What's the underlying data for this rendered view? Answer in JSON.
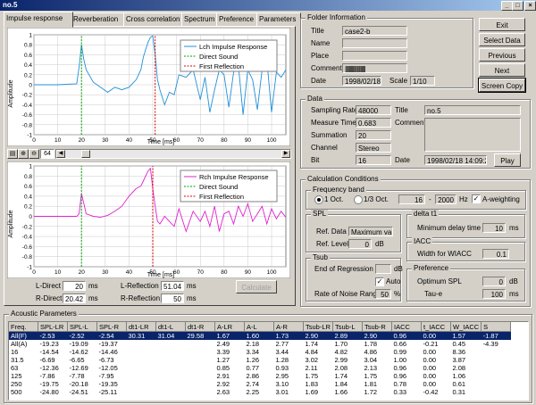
{
  "window": {
    "title": "no.5"
  },
  "tabs": [
    "Impulse response",
    "Reverberation",
    "Cross correlation",
    "Spectrum",
    "Preference",
    "Parameters"
  ],
  "chart_l": {
    "ylabel": "Amplitude",
    "xlabel": "Time [ms]",
    "yticks": [
      "1",
      "0.8",
      "0.6",
      "0.4",
      "0.2",
      "0",
      "-0.2",
      "-0.4",
      "-0.6",
      "-0.8",
      "-1"
    ],
    "xticks": [
      "0",
      "10",
      "20",
      "30",
      "40",
      "50",
      "60",
      "70",
      "80",
      "90",
      "100"
    ],
    "legend": [
      "Lch Impulse Response",
      "Direct Sound",
      "First Reflection"
    ]
  },
  "chart_r": {
    "ylabel": "Amplitude",
    "xlabel": "Time [ms]",
    "yticks": [
      "1",
      "0.8",
      "0.6",
      "0.4",
      "0.2",
      "0",
      "-0.2",
      "-0.4",
      "-0.6",
      "-0.8",
      "-1"
    ],
    "xticks": [
      "0",
      "10",
      "20",
      "30",
      "40",
      "50",
      "60",
      "70",
      "80",
      "90",
      "100"
    ],
    "legend": [
      "Rch Impulse Response",
      "Direct Sound",
      "First Reflection"
    ]
  },
  "chart_data": [
    {
      "type": "line",
      "name": "Lch",
      "xlabel": "Time [ms]",
      "ylabel": "Amplitude",
      "xlim": [
        0,
        106
      ],
      "ylim": [
        -1,
        1
      ],
      "grid": true,
      "series": [
        {
          "name": "Lch Impulse Response",
          "x": [
            0,
            10,
            18,
            19,
            20,
            21,
            22,
            25,
            28,
            31,
            34,
            37,
            40,
            43,
            45,
            46,
            47,
            48,
            49,
            50,
            51,
            52,
            53,
            55,
            57,
            59,
            61,
            64,
            67,
            70,
            72,
            74,
            76,
            78,
            80,
            82,
            84,
            86,
            88,
            90,
            92,
            94,
            96,
            98,
            100,
            102,
            104,
            106
          ],
          "y": [
            0,
            0,
            0.02,
            0.35,
            0.8,
            0.5,
            0.3,
            0.05,
            -0.05,
            -0.15,
            -0.05,
            -0.1,
            -0.05,
            0.1,
            0.3,
            0.55,
            0.7,
            0.85,
            0.95,
            0.98,
            0.6,
            0.1,
            -0.1,
            -0.4,
            -0.15,
            -0.2,
            0.2,
            0.15,
            0.3,
            -0.3,
            0.15,
            -0.55,
            -0.1,
            0.3,
            0.2,
            -0.45,
            0.25,
            0.4,
            -0.6,
            0.3,
            0.1,
            -0.5,
            0.3,
            0.5,
            -0.55,
            0.25,
            0.15,
            0.3
          ]
        },
        {
          "name": "Direct Sound",
          "x": [
            20,
            20
          ],
          "y": [
            -1,
            1
          ]
        },
        {
          "name": "First Reflection",
          "x": [
            51,
            51
          ],
          "y": [
            -1,
            1
          ]
        }
      ]
    },
    {
      "type": "line",
      "name": "Rch",
      "xlabel": "Time [ms]",
      "ylabel": "Amplitude",
      "xlim": [
        0,
        106
      ],
      "ylim": [
        -1,
        1
      ],
      "grid": true,
      "series": [
        {
          "name": "Rch Impulse Response",
          "x": [
            0,
            10,
            18,
            19,
            20,
            21,
            22,
            25,
            28,
            31,
            34,
            37,
            40,
            43,
            45,
            46,
            47,
            48,
            49,
            50,
            51,
            52,
            53,
            55,
            57,
            59,
            61,
            64,
            67,
            70,
            72,
            74,
            76,
            78,
            80,
            82,
            84,
            86,
            88,
            90,
            92,
            94,
            96,
            98,
            100,
            102,
            104,
            106
          ],
          "y": [
            0,
            0,
            0,
            0.05,
            0.45,
            0.25,
            0.05,
            0,
            -0.02,
            0.02,
            0.1,
            0.2,
            0.4,
            0.55,
            0.6,
            0.7,
            0.8,
            0.9,
            0.95,
            0.55,
            0.2,
            -0.1,
            -0.15,
            0,
            -0.1,
            -0.2,
            0.15,
            -0.3,
            0.1,
            -0.1,
            0.1,
            -0.2,
            0.2,
            -0.3,
            0.05,
            0.1,
            -0.15,
            0.2,
            0,
            0.25,
            -0.1,
            0.05,
            0.2,
            -0.15,
            0.15,
            -0.05,
            0.1,
            -0.02
          ]
        },
        {
          "name": "Direct Sound",
          "x": [
            20,
            20
          ],
          "y": [
            -1,
            1
          ]
        },
        {
          "name": "First Reflection",
          "x": [
            50,
            50
          ],
          "y": [
            -1,
            1
          ]
        }
      ]
    }
  ],
  "chart_toolbar": {
    "value": "64"
  },
  "direct": {
    "l_label": "L-Direct",
    "l_value": "20",
    "r_label": "R-Direct",
    "r_value": "20.42",
    "unit": "ms"
  },
  "reflection": {
    "l_label": "L-Reflection",
    "l_value": "51.04",
    "r_label": "R-Reflection",
    "r_value": "50",
    "unit": "ms"
  },
  "calc_button": "Calculate",
  "folder": {
    "title": "Folder Information",
    "title_label": "Title",
    "title_value": "case2-b",
    "name_label": "Name",
    "place_label": "Place",
    "comment_label": "Comment",
    "comment_value": "|||||||||||||||||||||",
    "date_label": "Date",
    "date_value": "1998/02/18",
    "scale_label": "Scale",
    "scale_value": "1/10"
  },
  "buttons": {
    "exit": "Exit",
    "select": "Select Data",
    "previous": "Previous",
    "next": "Next",
    "copy": "Screen Copy"
  },
  "data": {
    "title": "Data",
    "rate_label": "Sampling Rate",
    "rate_value": "48000",
    "mtime_label": "Measure Time",
    "mtime_value": "0.683",
    "sum_label": "Summation",
    "sum_value": "20",
    "chan_label": "Channel",
    "chan_value": "Stereo",
    "bit_label": "Bit",
    "bit_value": "16",
    "title_label": "Title",
    "title_value": "no.5",
    "comment_label": "Comment",
    "date_label": "Date",
    "date_value": "1998/02/18 14:09:20",
    "play": "Play"
  },
  "calc": {
    "title": "Calculation Conditions",
    "band_title": "Frequency band",
    "opt1": "1 Oct.",
    "opt2": "1/3 Oct.",
    "f_lo": "16",
    "f_hi": "2000",
    "hz": "Hz",
    "aweight": "A-weighting",
    "spl_title": "SPL",
    "ref_data_label": "Ref. Data",
    "ref_data_value": "Maximum value",
    "ref_level_label": "Ref. Level",
    "ref_level_value": "0",
    "db": "dB",
    "delta_title": "delta t1",
    "min_delay_label": "Minimum delay time",
    "min_delay_value": "10",
    "ms": "ms",
    "iacc_title": "IACC",
    "wiacc_label": "Width for WIACC",
    "wiacc_value": "0.1",
    "tsub_title": "Tsub",
    "end_reg_label": "End of Regression",
    "auto": "Auto",
    "rate_noise_label": "Rate of Noise Range",
    "rate_noise_value": "50",
    "pct": "%",
    "pref_title": "Preference",
    "opt_spl_label": "Optimum SPL",
    "opt_spl_value": "0",
    "taue_label": "Tau-e",
    "taue_value": "100"
  },
  "acoustic": {
    "title": "Acoustic Parameters",
    "columns": [
      "Freq.",
      "SPL-LR",
      "SPL-L",
      "SPL-R",
      "dt1-LR",
      "dt1-L",
      "dt1-R",
      "A-LR",
      "A-L",
      "A-R",
      "Tsub-LR",
      "Tsub-L",
      "Tsub-R",
      "IACC",
      "t_IACC",
      "W_IACC",
      "S"
    ],
    "rows": [
      [
        "All(F)",
        "-2.53",
        "-2.52",
        "-2.54",
        "30.31",
        "31.04",
        "29.58",
        "1.67",
        "1.60",
        "1.73",
        "2.90",
        "2.89",
        "2.90",
        "0.96",
        "0.00",
        "1.57",
        "-1.87"
      ],
      [
        "All(A)",
        "-19.23",
        "-19.09",
        "-19.37",
        "",
        "",
        "",
        "2.49",
        "2.18",
        "2.77",
        "1.74",
        "1.70",
        "1.78",
        "0.66",
        "-0.21",
        "0.45",
        "-4.39"
      ],
      [
        "16",
        "-14.54",
        "-14.62",
        "-14.46",
        "",
        "",
        "",
        "3.39",
        "3.34",
        "3.44",
        "4.84",
        "4.82",
        "4.86",
        "0.99",
        "0.00",
        "8.36",
        ""
      ],
      [
        "31.5",
        "-6.69",
        "-6.65",
        "-6.73",
        "",
        "",
        "",
        "1.27",
        "1.26",
        "1.28",
        "3.02",
        "2.99",
        "3.04",
        "1.00",
        "0.00",
        "3.87",
        ""
      ],
      [
        "63",
        "-12.36",
        "-12.69",
        "-12.05",
        "",
        "",
        "",
        "0.85",
        "0.77",
        "0.93",
        "2.11",
        "2.08",
        "2.13",
        "0.96",
        "0.00",
        "2.08",
        ""
      ],
      [
        "125",
        "-7.86",
        "-7.78",
        "-7.95",
        "",
        "",
        "",
        "2.91",
        "2.86",
        "2.95",
        "1.75",
        "1.74",
        "1.75",
        "0.96",
        "0.00",
        "1.06",
        ""
      ],
      [
        "250",
        "-19.75",
        "-20.18",
        "-19.35",
        "",
        "",
        "",
        "2.92",
        "2.74",
        "3.10",
        "1.83",
        "1.84",
        "1.81",
        "0.78",
        "0.00",
        "0.61",
        ""
      ],
      [
        "500",
        "-24.80",
        "-24.51",
        "-25.11",
        "",
        "",
        "",
        "2.63",
        "2.25",
        "3.01",
        "1.69",
        "1.66",
        "1.72",
        "0.33",
        "-0.42",
        "0.31",
        ""
      ]
    ]
  }
}
